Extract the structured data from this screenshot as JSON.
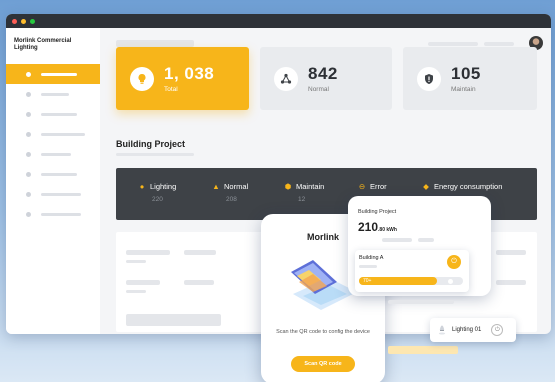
{
  "window": {
    "brand": "Morlink Commercial Lighting",
    "colors": {
      "accent": "#f7b51a",
      "dark": "#3e4247",
      "dot_red": "#ff5f56",
      "dot_yellow": "#ffbd2e",
      "dot_green": "#27c93f"
    }
  },
  "stats": [
    {
      "value": "1, 038",
      "label": "Total",
      "icon": "lightbulb-icon"
    },
    {
      "value": "842",
      "label": "Normal",
      "icon": "network-icon"
    },
    {
      "value": "105",
      "label": "Maintain",
      "icon": "shield-alert-icon"
    }
  ],
  "section": {
    "title": "Building Project"
  },
  "summary": [
    {
      "label": "Lighting",
      "value": "220",
      "icon": "lightbulb-icon"
    },
    {
      "label": "Normal",
      "value": "208",
      "icon": "network-icon"
    },
    {
      "label": "Maintain",
      "value": "12",
      "icon": "shield-alert-icon"
    },
    {
      "label": "Error",
      "value": "",
      "icon": "error-icon"
    },
    {
      "label": "Energy consumption",
      "value": "",
      "icon": "energy-icon"
    }
  ],
  "phone": {
    "title": "Morlink",
    "message": "Scan the QR code to config the device",
    "button": "Scan QR code"
  },
  "project_card": {
    "label": "Building Project",
    "value": "210",
    "unit": ".80 kWh",
    "building_label": "Building A",
    "slider_label": "70+"
  },
  "lighting_card": {
    "label": "Lighting 01"
  }
}
